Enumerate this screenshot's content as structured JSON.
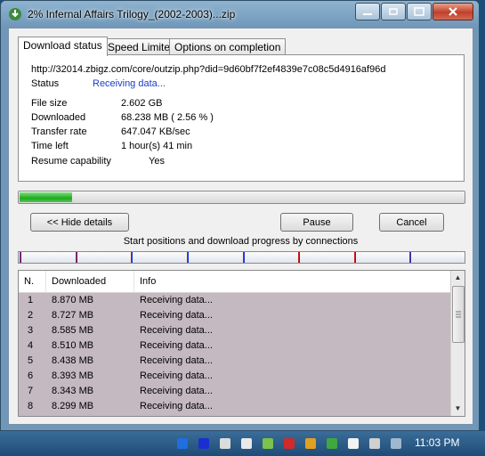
{
  "window": {
    "title": "2% Infernal Affairs Trilogy_(2002-2003)...zip"
  },
  "tabs": [
    {
      "label": "Download status",
      "active": true
    },
    {
      "label": "Speed Limiter",
      "active": false
    },
    {
      "label": "Options on completion",
      "active": false
    }
  ],
  "status_panel": {
    "url": "http://32014.zbigz.com/core/outzip.php?did=9d60bf7f2ef4839e7c08c5d4916af96d",
    "status_label": "Status",
    "status_value": "Receiving data...",
    "file_size_label": "File size",
    "file_size_value": "2.602  GB",
    "downloaded_label": "Downloaded",
    "downloaded_value": "68.238  MB  ( 2.56 % )",
    "transfer_rate_label": "Transfer rate",
    "transfer_rate_value": "647.047  KB/sec",
    "time_left_label": "Time left",
    "time_left_value": "1 hour(s) 41 min",
    "resume_label": "Resume capability",
    "resume_value": "Yes"
  },
  "progress_fraction": 0.0256,
  "buttons": {
    "hide_details": "<< Hide details",
    "pause": "Pause",
    "cancel": "Cancel"
  },
  "connections": {
    "label": "Start positions and download progress by connections",
    "marker_color_start": "#d01a1a",
    "marker_color_progress": "#1a2fd0"
  },
  "table": {
    "headers": [
      "N.",
      "Downloaded",
      "Info"
    ],
    "rows": [
      {
        "n": "1",
        "downloaded": "8.870  MB",
        "info": "Receiving data..."
      },
      {
        "n": "2",
        "downloaded": "8.727  MB",
        "info": "Receiving data..."
      },
      {
        "n": "3",
        "downloaded": "8.585  MB",
        "info": "Receiving data..."
      },
      {
        "n": "4",
        "downloaded": "8.510  MB",
        "info": "Receiving data..."
      },
      {
        "n": "5",
        "downloaded": "8.438  MB",
        "info": "Receiving data..."
      },
      {
        "n": "6",
        "downloaded": "8.393  MB",
        "info": "Receiving data..."
      },
      {
        "n": "7",
        "downloaded": "8.343  MB",
        "info": "Receiving data..."
      },
      {
        "n": "8",
        "downloaded": "8.299  MB",
        "info": "Receiving data..."
      }
    ]
  },
  "taskbar": {
    "clock": "11:03 PM",
    "tray_icons": [
      "flag-icon",
      "display-icon",
      "speaker-icon",
      "network-icon",
      "download-icon",
      "antivirus-icon",
      "app-icon",
      "shield-icon",
      "flag-notify-icon",
      "device-icon",
      "monitor-icon"
    ]
  },
  "colors": {
    "progress_green": "#1fa81f",
    "status_blue": "#1a3fc8",
    "row_background": "#c4b9c0"
  }
}
